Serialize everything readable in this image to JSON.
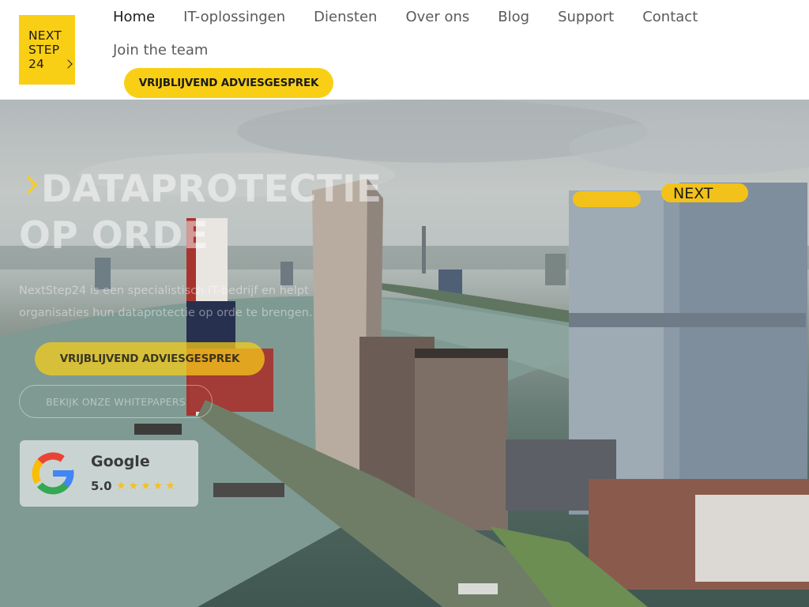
{
  "brand": {
    "logo_lines": [
      "NEXT",
      "STEP",
      "24"
    ],
    "accent_color": "#f9cf16"
  },
  "nav": {
    "items": [
      {
        "label": "Home",
        "active": true
      },
      {
        "label": "IT-oplossingen"
      },
      {
        "label": "Diensten"
      },
      {
        "label": "Over ons"
      },
      {
        "label": "Blog"
      },
      {
        "label": "Support"
      },
      {
        "label": "Contact"
      },
      {
        "label": "Join the team"
      }
    ]
  },
  "header": {
    "cta_label": "VRIJBLIJVEND ADVIESGESPREK"
  },
  "hero": {
    "title_line1": "DATAPROTECTIE",
    "title_line2": "OP ORDE",
    "text": "NextStep24 is een specialistisch IT-bedrijf en helpt organisaties hun dataprotectie op orde te brengen.",
    "primary_cta": "VRIJBLIJVEND ADVIESGESPREK",
    "secondary_cta": "BEKIJK ONZE WHITEPAPERS",
    "building_sign": "NEXT",
    "background_icon": "rotterdam-skyline-photo"
  },
  "review": {
    "brand": "Google",
    "score": "5.0",
    "stars": "★★★★★",
    "rating": 5,
    "star_color": "#f4c21a"
  }
}
